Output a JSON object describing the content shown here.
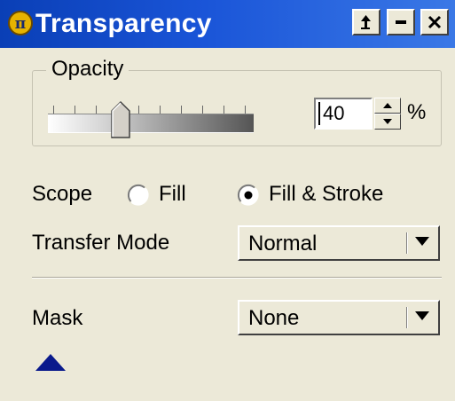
{
  "window": {
    "title": "Transparency",
    "icon": "pi-icon",
    "buttons": [
      "restore-up-icon",
      "minimize-icon",
      "close-icon"
    ]
  },
  "opacity": {
    "group_label": "Opacity",
    "value": "40",
    "unit": "%",
    "slider_fraction": 0.4
  },
  "scope": {
    "label": "Scope",
    "options": [
      {
        "label": "Fill",
        "selected": false
      },
      {
        "label": "Fill & Stroke",
        "selected": true
      }
    ]
  },
  "transfer_mode": {
    "label": "Transfer Mode",
    "value": "Normal"
  },
  "mask": {
    "label": "Mask",
    "value": "None"
  },
  "colors": {
    "titlebar": "#1a55d8",
    "face": "#ece9d8",
    "collapse_arrow": "#0a1a8c"
  }
}
